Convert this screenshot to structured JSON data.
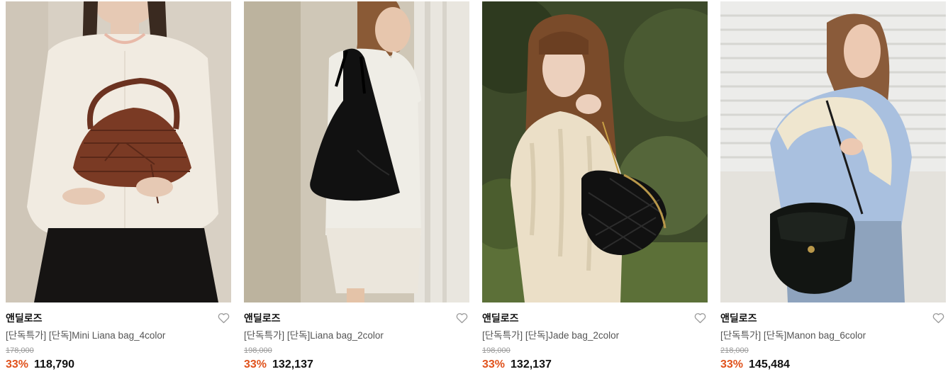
{
  "colors": {
    "discount": "#e0521c",
    "brand_text": "#111111",
    "title_text": "#555555",
    "original_price": "#999999"
  },
  "products": [
    {
      "brand": "앤딜로즈",
      "title": "[단독특가] [단독]Mini Liana bag_4color",
      "original_price": "178,000",
      "discount": "33%",
      "price": "118,790",
      "image": "model-white-cardigan-brown-croc-handbag",
      "wish_icon": "heart-outline-icon"
    },
    {
      "brand": "앤딜로즈",
      "title": "[단독특가] [단독]Liana bag_2color",
      "original_price": "198,000",
      "discount": "33%",
      "price": "132,137",
      "image": "model-white-shirt-black-shoulder-bag",
      "wish_icon": "heart-outline-icon"
    },
    {
      "brand": "앤딜로즈",
      "title": "[단독특가] [단독]Jade bag_2color",
      "original_price": "198,000",
      "discount": "33%",
      "price": "132,137",
      "image": "model-cable-knit-black-quilted-bag",
      "wish_icon": "heart-outline-icon"
    },
    {
      "brand": "앤딜로즈",
      "title": "[단독특가] [단독]Manon bag_6color",
      "original_price": "218,000",
      "discount": "33%",
      "price": "145,484",
      "image": "model-blue-shirt-black-backpack",
      "wish_icon": "heart-outline-icon"
    }
  ]
}
